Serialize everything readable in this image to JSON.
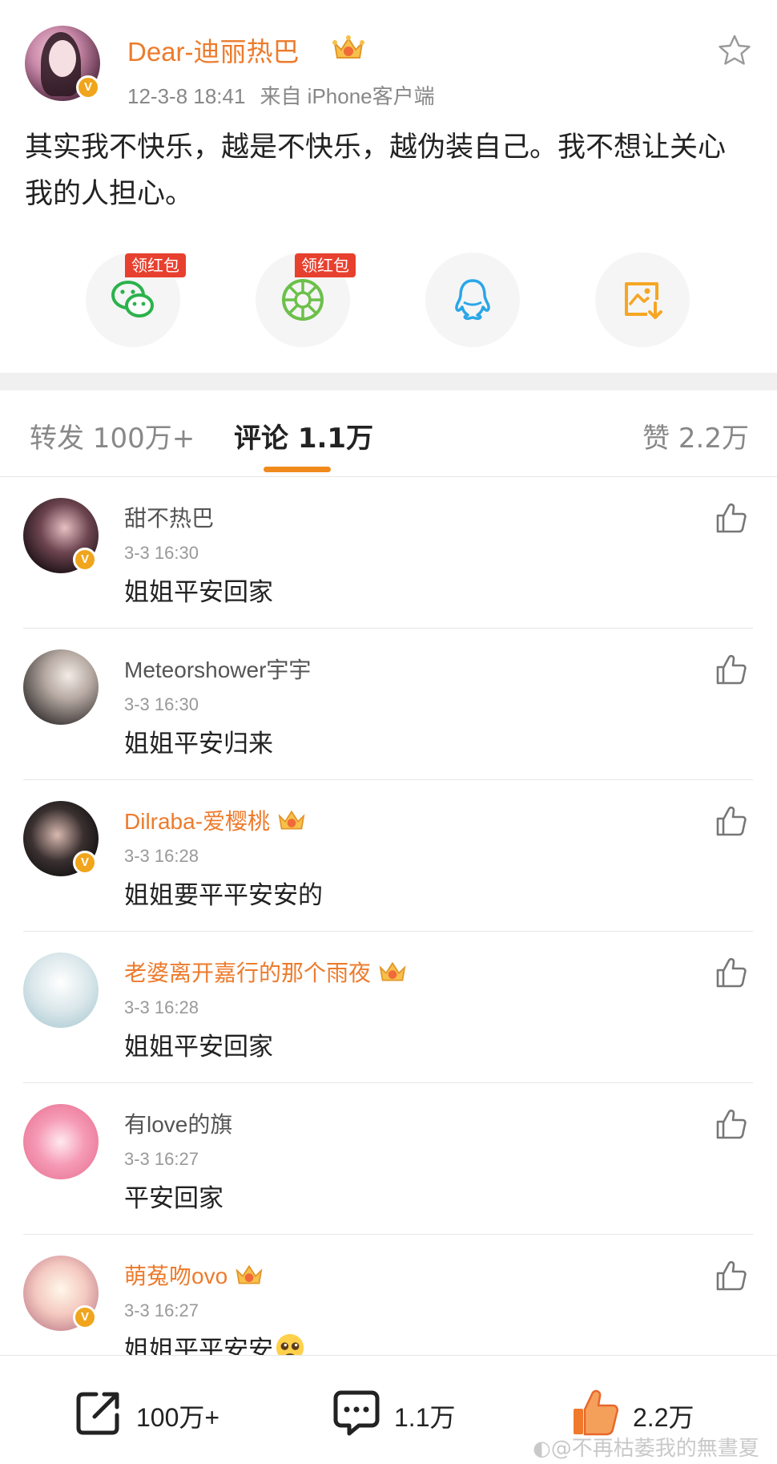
{
  "post": {
    "author": "Dear-迪丽热巴",
    "time": "12-3-8 18:41",
    "source": "来自 iPhone客户端",
    "text": "其实我不快乐，越是不快乐，越伪装自己。我不想让关心我的人担心。",
    "verified_badge": "V"
  },
  "share": {
    "tag1": "领红包",
    "tag2": "领红包",
    "icons": [
      "wechat-icon",
      "moments-icon",
      "qq-icon",
      "save-image-icon"
    ]
  },
  "tabs": {
    "repost": "转发 100万+",
    "comments": "评论 1.1万",
    "likes": "赞 2.2万"
  },
  "comments": [
    {
      "name": "甜不热巴",
      "time": "3-3 16:30",
      "text": "姐姐平安回家",
      "verified": "V"
    },
    {
      "name": "Meteorshower宇宇",
      "time": "3-3 16:30",
      "text": "姐姐平安归来"
    },
    {
      "name": "Dilraba-爱樱桃",
      "time": "3-3 16:28",
      "text": "姐姐要平平安安的",
      "verified": "V"
    },
    {
      "name": "老婆离开嘉行的那个雨夜",
      "time": "3-3 16:28",
      "text": "姐姐平安回家"
    },
    {
      "name": "有love的旗",
      "time": "3-3 16:27",
      "text": "平安回家"
    },
    {
      "name": "萌菟吻ovo",
      "time": "3-3 16:27",
      "text": "姐姐平平安安",
      "verified": "V"
    }
  ],
  "bottom": {
    "repost": "100万+",
    "comment": "1.1万",
    "like": "2.2万"
  },
  "watermark": "@不再枯萎我的無晝夏",
  "colors": {
    "accent_orange": "#ed7b2c",
    "tab_underline": "#f08a1c",
    "red_tag": "#e8402f",
    "wechat_green": "#2bb24c",
    "qq_blue": "#2aa6e8",
    "save_yellow": "#f5a623"
  }
}
